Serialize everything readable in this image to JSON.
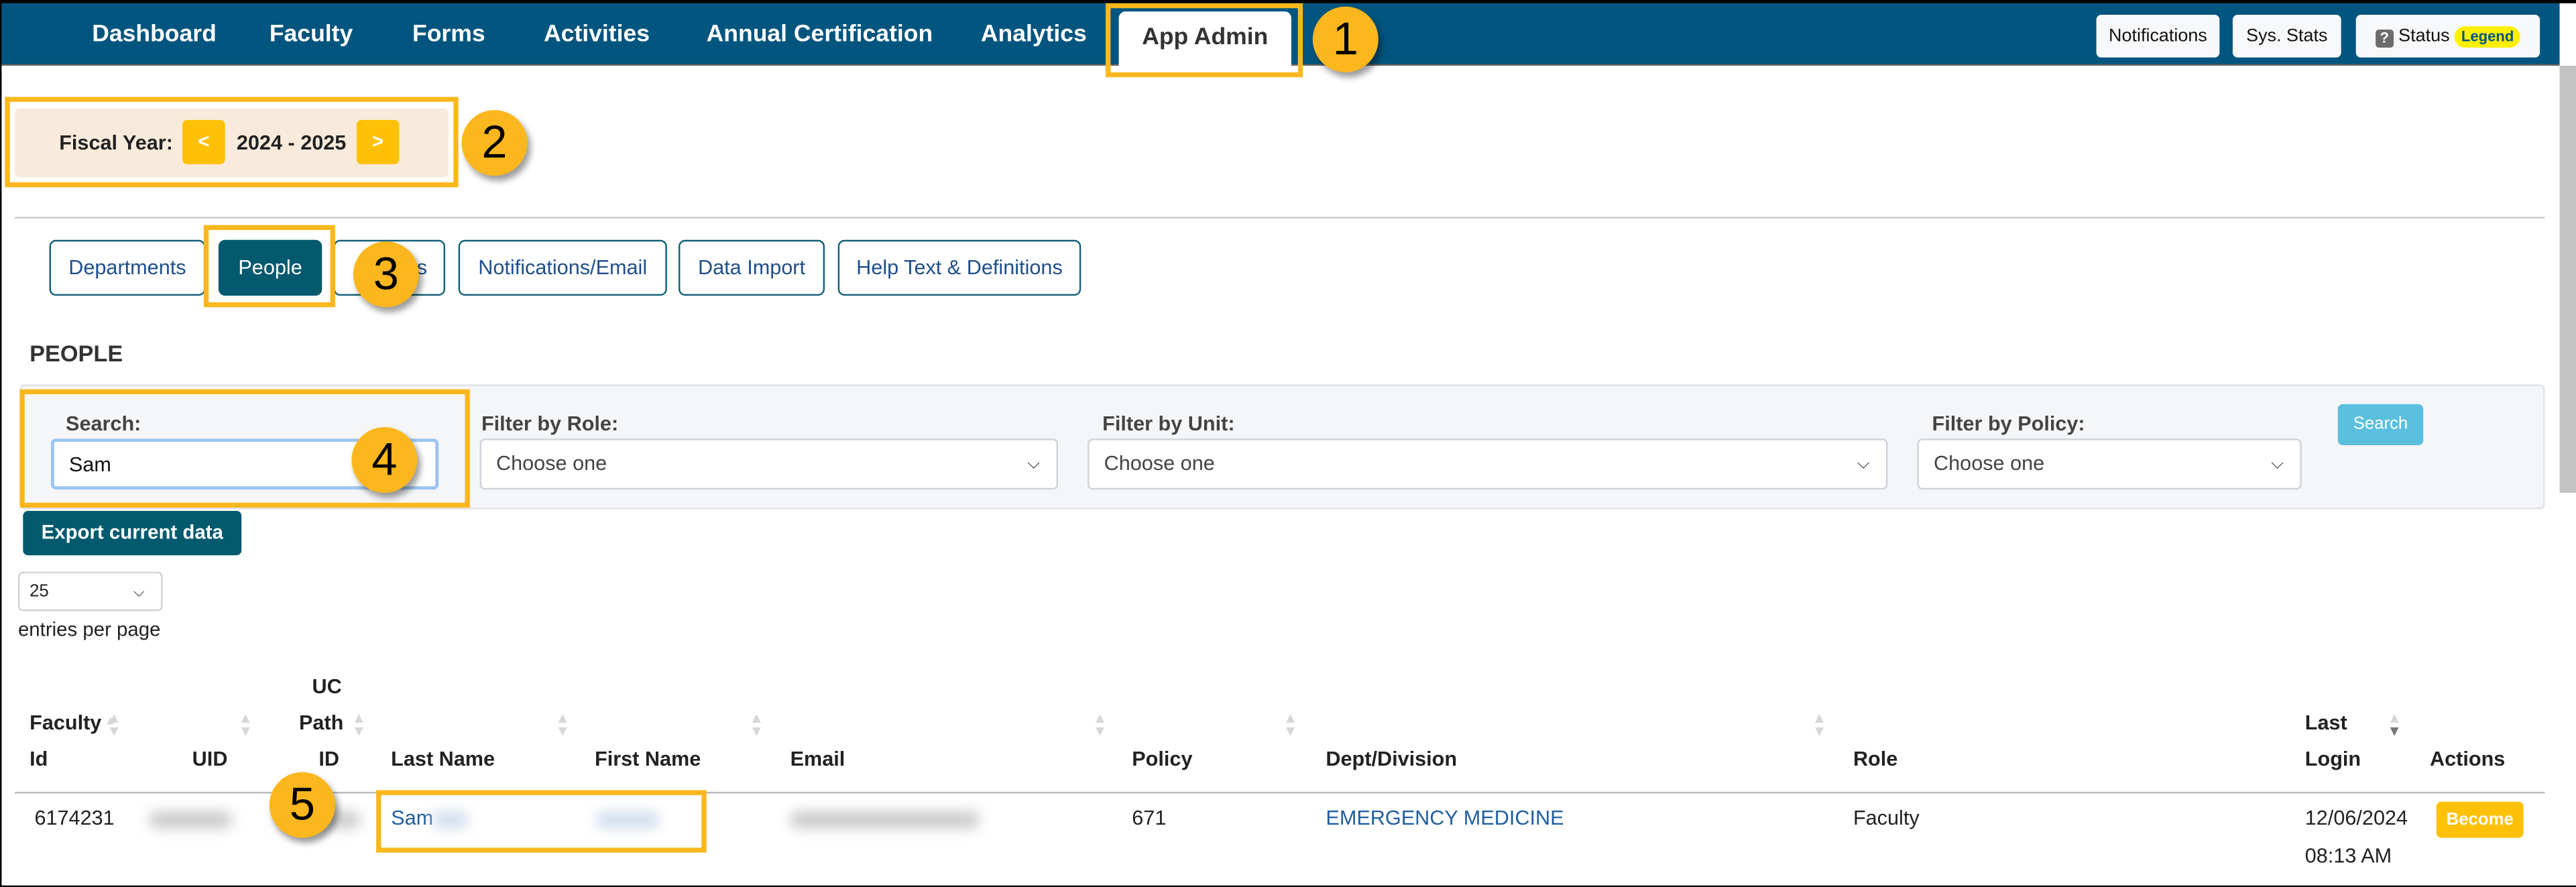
{
  "nav": {
    "items": [
      "Dashboard",
      "Faculty",
      "Forms",
      "Activities",
      "Annual Certification",
      "Analytics"
    ],
    "active": "App Admin",
    "buttons": {
      "notifications": "Notifications",
      "sys_stats": "Sys. Stats",
      "status": "Status",
      "legend": "Legend"
    }
  },
  "fiscal_year": {
    "label": "Fiscal Year:",
    "value": "2024 - 2025",
    "prev": "<",
    "next": ">"
  },
  "tabs": [
    "Departments",
    "People",
    "s",
    "Notifications/Email",
    "Data Import",
    "Help Text & Definitions"
  ],
  "active_tab": "People",
  "section_title": "PEOPLE",
  "filters": {
    "search_label": "Search:",
    "search_value": "Sam",
    "role_label": "Filter by Role:",
    "role_value": "Choose one",
    "unit_label": "Filter by Unit:",
    "unit_value": "Choose one",
    "policy_label": "Filter by Policy:",
    "policy_value": "Choose one",
    "search_button": "Search"
  },
  "export_button": "Export current data",
  "page_size": {
    "value": "25",
    "label": "entries per page"
  },
  "table": {
    "headers": {
      "faculty_id": [
        "Faculty",
        "Id"
      ],
      "uid": "UID",
      "uc_path_id": [
        "UC",
        "Path",
        "ID"
      ],
      "last_name": "Last Name",
      "first_name": "First Name",
      "email": "Email",
      "policy": "Policy",
      "dept": "Dept/Division",
      "role": "Role",
      "last_login": [
        "Last",
        "Login"
      ],
      "actions": "Actions"
    },
    "rows": [
      {
        "faculty_id": "6174231",
        "last_name": "Sam",
        "policy": "671",
        "dept": "EMERGENCY MEDICINE",
        "role": "Faculty",
        "last_login": [
          "12/06/2024",
          "08:13 AM"
        ],
        "action": "Become"
      }
    ]
  },
  "annotations": [
    "1",
    "2",
    "3",
    "4",
    "5"
  ],
  "colors": {
    "nav": "#02557f",
    "accent": "#ffc107",
    "annotation": "#fbb71d",
    "primary_dark": "#035a6e",
    "info": "#5bc0de"
  }
}
